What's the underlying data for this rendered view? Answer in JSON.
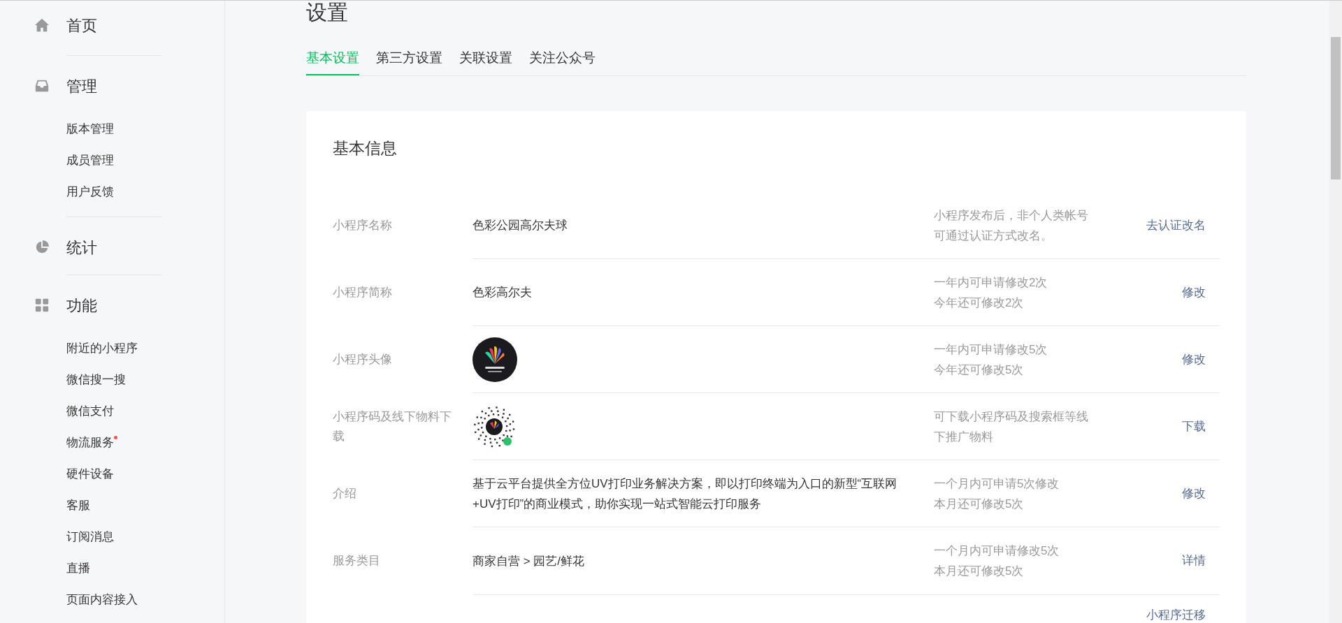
{
  "sidebar": {
    "sections": [
      {
        "kind": "home",
        "label": "首页"
      },
      {
        "kind": "inbox",
        "label": "管理",
        "items": [
          {
            "label": "版本管理",
            "dot": false
          },
          {
            "label": "成员管理",
            "dot": false
          },
          {
            "label": "用户反馈",
            "dot": false
          }
        ]
      },
      {
        "kind": "pie",
        "label": "统计"
      },
      {
        "kind": "grid",
        "label": "功能",
        "items": [
          {
            "label": "附近的小程序",
            "dot": false
          },
          {
            "label": "微信搜一搜",
            "dot": false
          },
          {
            "label": "微信支付",
            "dot": false
          },
          {
            "label": "物流服务",
            "dot": true
          },
          {
            "label": "硬件设备",
            "dot": false
          },
          {
            "label": "客服",
            "dot": false
          },
          {
            "label": "订阅消息",
            "dot": false
          },
          {
            "label": "直播",
            "dot": false
          },
          {
            "label": "页面内容接入",
            "dot": false
          }
        ]
      }
    ]
  },
  "page_title": "设置",
  "tabs": [
    {
      "label": "基本设置",
      "selected": true
    },
    {
      "label": "第三方设置",
      "selected": false
    },
    {
      "label": "关联设置",
      "selected": false
    },
    {
      "label": "关注公众号",
      "selected": false
    }
  ],
  "card": {
    "title": "基本信息",
    "rows": [
      {
        "label": "小程序名称",
        "kind": "text",
        "value": "色彩公园高尔夫球",
        "hint": [
          "小程序发布后，非个人类帐号",
          "可通过认证方式改名。"
        ],
        "action": "去认证改名"
      },
      {
        "label": "小程序简称",
        "kind": "text",
        "value": "色彩高尔夫",
        "hint": [
          "一年内可申请修改2次",
          "今年还可修改2次"
        ],
        "action": "修改"
      },
      {
        "label": "小程序头像",
        "kind": "avatar",
        "hint": [
          "一年内可申请修改5次",
          "今年还可修改5次"
        ],
        "action": "修改"
      },
      {
        "label": "小程序码及线下物料下载",
        "kind": "qrcode",
        "hint": [
          "可下载小程序码及搜索框等线",
          "下推广物料"
        ],
        "action": "下载"
      },
      {
        "label": "介绍",
        "kind": "text",
        "value": "基于云平台提供全方位UV打印业务解决方案，即以打印终端为入口的新型“互联网+UV打印”的商业模式，助你实现一站式智能云打印服务",
        "hint": [
          "一个月内可申请5次修改",
          "本月还可修改5次"
        ],
        "action": "修改"
      },
      {
        "label": "服务类目",
        "kind": "text",
        "value": "商家自营 > 园艺/鲜花",
        "hint": [
          "一个月内可申请修改5次",
          "本月还可修改5次"
        ],
        "action": "详情"
      }
    ],
    "footer_link": "小程序迁移"
  }
}
